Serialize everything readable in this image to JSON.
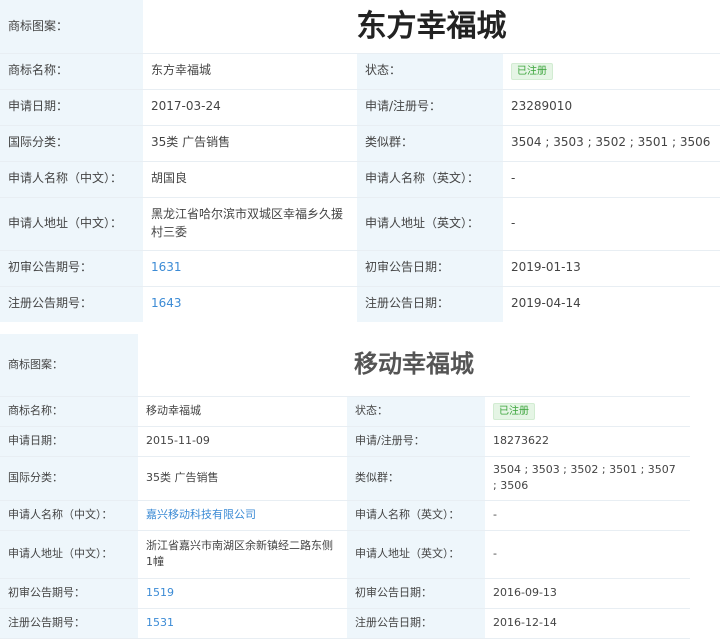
{
  "records": [
    {
      "logo_label": "商标图案：",
      "logo_text": "东方幸福城",
      "name_label": "商标名称：",
      "name": "东方幸福城",
      "status_label": "状态：",
      "status": "已注册",
      "apply_date_label": "申请日期：",
      "apply_date": "2017-03-24",
      "reg_no_label": "申请/注册号：",
      "reg_no": "23289010",
      "class_label": "国际分类：",
      "class": "35类 广告销售",
      "similar_label": "类似群：",
      "similar": "3504 ; 3503 ; 3502 ; 3501 ; 3506",
      "applicant_cn_label": "申请人名称（中文）：",
      "applicant_cn": "胡国良",
      "applicant_en_label": "申请人名称（英文）：",
      "applicant_en": "-",
      "address_cn_label": "申请人地址（中文）：",
      "address_cn": "黑龙江省哈尔滨市双城区幸福乡久援村三委",
      "address_en_label": "申请人地址（英文）：",
      "address_en": "-",
      "prelim_no_label": "初审公告期号：",
      "prelim_no": "1631",
      "prelim_date_label": "初审公告日期：",
      "prelim_date": "2019-01-13",
      "reg_pub_no_label": "注册公告期号：",
      "reg_pub_no": "1643",
      "reg_pub_date_label": "注册公告日期：",
      "reg_pub_date": "2019-04-14"
    },
    {
      "logo_label": "商标图案：",
      "logo_text": "移动幸福城",
      "name_label": "商标名称：",
      "name": "移动幸福城",
      "status_label": "状态：",
      "status": "已注册",
      "apply_date_label": "申请日期：",
      "apply_date": "2015-11-09",
      "reg_no_label": "申请/注册号：",
      "reg_no": "18273622",
      "class_label": "国际分类：",
      "class": "35类 广告销售",
      "similar_label": "类似群：",
      "similar": "3504 ; 3503 ; 3502 ; 3501 ; 3507 ; 3506",
      "applicant_cn_label": "申请人名称（中文）：",
      "applicant_cn": "嘉兴移动科技有限公司",
      "applicant_en_label": "申请人名称（英文）：",
      "applicant_en": "-",
      "address_cn_label": "申请人地址（中文）：",
      "address_cn": "浙江省嘉兴市南湖区余新镇经二路东侧1幢",
      "address_en_label": "申请人地址（英文）：",
      "address_en": "-",
      "prelim_no_label": "初审公告期号：",
      "prelim_no": "1519",
      "prelim_date_label": "初审公告日期：",
      "prelim_date": "2016-09-13",
      "reg_pub_no_label": "注册公告期号：",
      "reg_pub_no": "1531",
      "reg_pub_date_label": "注册公告日期：",
      "reg_pub_date": "2016-12-14"
    }
  ],
  "colors": {
    "label_bg": "#eef6fb",
    "link": "#3c8bd5",
    "badge_text": "#3aa43a",
    "badge_bg": "#e5f5e5",
    "divider": "#e8eef3"
  }
}
